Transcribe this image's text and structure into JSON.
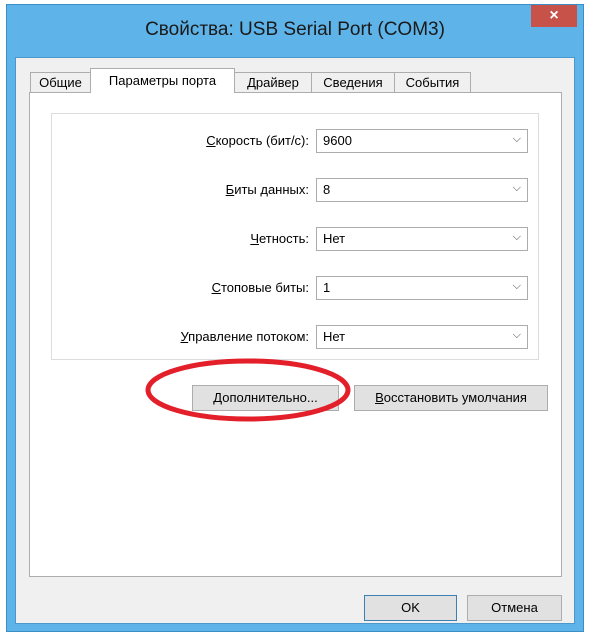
{
  "window": {
    "title": "Свойства: USB Serial Port (COM3)",
    "close_label": "×"
  },
  "tabs": [
    {
      "label": "Общие"
    },
    {
      "label": "Параметры порта"
    },
    {
      "label": "Драйвер"
    },
    {
      "label": "Сведения"
    },
    {
      "label": "События"
    }
  ],
  "active_tab": "Параметры порта",
  "settings": [
    {
      "accel": "С",
      "label": "корость (бит/с):",
      "value": "9600"
    },
    {
      "accel": "Б",
      "label": "иты данных:",
      "value": "8"
    },
    {
      "accel": "Ч",
      "label": "етность:",
      "value": "Нет"
    },
    {
      "accel": "С",
      "label": "топовые биты:",
      "value": "1"
    },
    {
      "accel": "У",
      "label": "правление потоком:",
      "value": "Нет"
    }
  ],
  "buttons": {
    "advanced_accel": "Д",
    "advanced_rest": "ополнительно...",
    "restore_accel": "В",
    "restore_rest": "осстановить умолчания",
    "ok": "OK",
    "cancel": "Отмена"
  },
  "colors": {
    "title_bar": "#5eb3e8",
    "close_button": "#c7524a",
    "annotation": "#e3202a"
  },
  "icons": {
    "dropdown": "chevron-down-icon",
    "close": "close-icon"
  }
}
